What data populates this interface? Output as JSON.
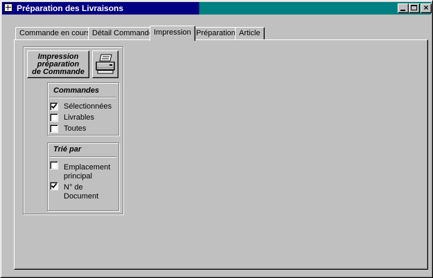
{
  "window": {
    "title": "Préparation des Livraisons",
    "minimize_glyph": "_",
    "maximize_glyph": "□",
    "close_glyph": "×"
  },
  "tabs": [
    {
      "label": "Commande en cours",
      "active": false
    },
    {
      "label": "Détail Commande",
      "active": false
    },
    {
      "label": "Impression",
      "active": true
    },
    {
      "label": "Préparation",
      "active": false
    },
    {
      "label": "Article",
      "active": false
    }
  ],
  "print_button": {
    "line1": "Impression",
    "line2": "préparation",
    "line3": "de Commande",
    "icon": "printer-icon"
  },
  "commandes_group": {
    "label": "Commandes",
    "options": [
      {
        "label": "Sélectionnées",
        "checked": true
      },
      {
        "label": "Livrables",
        "checked": false
      },
      {
        "label": "Toutes",
        "checked": false
      }
    ]
  },
  "tri_group": {
    "label": "Trié par",
    "options": [
      {
        "line1": "Emplacement",
        "line2": "principal",
        "checked": false
      },
      {
        "line1": "N° de",
        "line2": "Document",
        "checked": true
      }
    ]
  },
  "colors": {
    "title_active": "#000080",
    "title_right": "#008080",
    "face": "#c0c0c0"
  }
}
